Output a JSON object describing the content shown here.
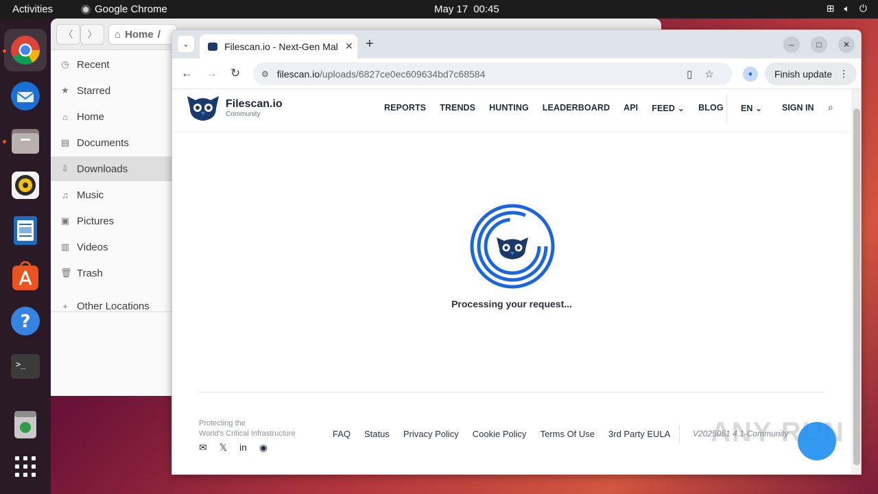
{
  "topbar": {
    "activities": "Activities",
    "app_name": "Google Chrome",
    "date": "May 17",
    "time": "00:45"
  },
  "dock": {
    "items": [
      "chrome-icon",
      "thunderbird-icon",
      "files-icon",
      "rhythmbox-icon",
      "writer-icon",
      "app-center-icon",
      "help-icon",
      "terminal-icon",
      "trash-icon",
      "app-grid-icon"
    ]
  },
  "files": {
    "path_home": "Home",
    "sidebar": [
      {
        "label": "Recent",
        "icon": "clock-icon"
      },
      {
        "label": "Starred",
        "icon": "star-icon"
      },
      {
        "label": "Home",
        "icon": "home-icon"
      },
      {
        "label": "Documents",
        "icon": "document-icon"
      },
      {
        "label": "Downloads",
        "icon": "download-icon"
      },
      {
        "label": "Music",
        "icon": "music-icon"
      },
      {
        "label": "Pictures",
        "icon": "picture-icon"
      },
      {
        "label": "Videos",
        "icon": "video-icon"
      },
      {
        "label": "Trash",
        "icon": "trash-icon"
      },
      {
        "label": "Other Locations",
        "icon": "plus-icon"
      }
    ]
  },
  "chrome": {
    "tab_title": "Filescan.io - Next-Gen Malware Analysis",
    "url_host": "filescan.io",
    "url_path": "/uploads/6827ce0ec609634bd7c68584",
    "finish_update": "Finish update"
  },
  "site": {
    "brand": "Filescan.io",
    "brand_sub": "Community",
    "nav": [
      "REPORTS",
      "TRENDS",
      "HUNTING",
      "LEADERBOARD",
      "API",
      "FEED"
    ],
    "blog": "BLOG",
    "lang": "EN",
    "signin": "SIGN IN",
    "processing": "Processing your request...",
    "tagline_1": "Protecting the",
    "tagline_2": "World's Critical Infrastructure",
    "footer_links": [
      "FAQ",
      "Status",
      "Privacy Policy",
      "Cookie Policy",
      "Terms Of Use",
      "3rd Party EULA"
    ],
    "version": "V2025051 4.1-Community",
    "watermark": "ANY RUN"
  },
  "colors": {
    "accent_blue": "#1a66e0",
    "owl_dark": "#1a3a6b"
  }
}
